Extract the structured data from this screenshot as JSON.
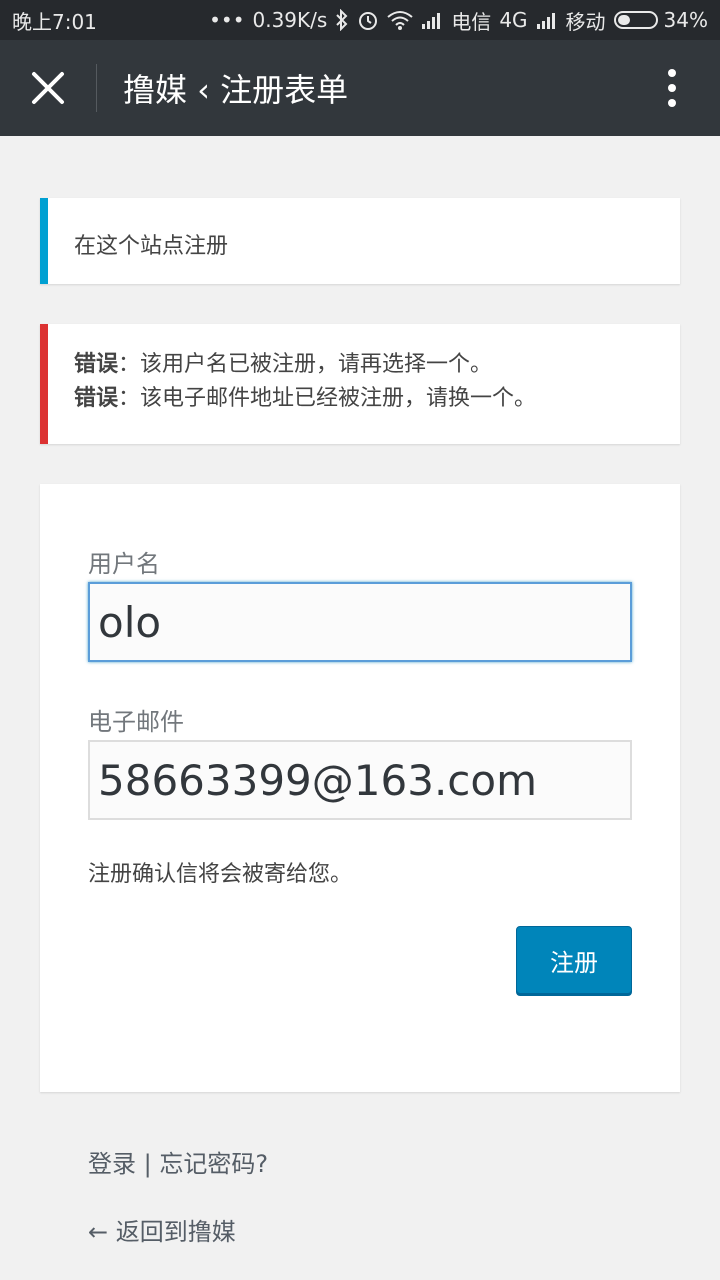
{
  "status_bar": {
    "time": "晚上7:01",
    "net_speed": "0.39K/s",
    "carrier1": "电信",
    "network": "4G",
    "carrier2": "移动",
    "battery_percent": "34%",
    "battery_level": 0.34
  },
  "app_bar": {
    "title": "撸媒 ‹ 注册表单"
  },
  "notices": {
    "info": "在这个站点注册",
    "errors": [
      {
        "label": "错误",
        "message": "：该用户名已被注册，请再选择一个。"
      },
      {
        "label": "错误",
        "message": "：该电子邮件地址已经被注册，请换一个。"
      }
    ]
  },
  "form": {
    "username_label": "用户名",
    "username_value": "olo",
    "email_label": "电子邮件",
    "email_value": "58663399@163.com",
    "hint": "注册确认信将会被寄给您。",
    "submit_label": "注册"
  },
  "footer": {
    "login_link": "登录",
    "separator": " | ",
    "forgot_link": "忘记密码?",
    "back_link": "← 返回到撸媒"
  },
  "colors": {
    "info_accent": "#00a0d2",
    "error_accent": "#dc3232",
    "button": "#0085ba",
    "app_bar": "#32373c"
  }
}
